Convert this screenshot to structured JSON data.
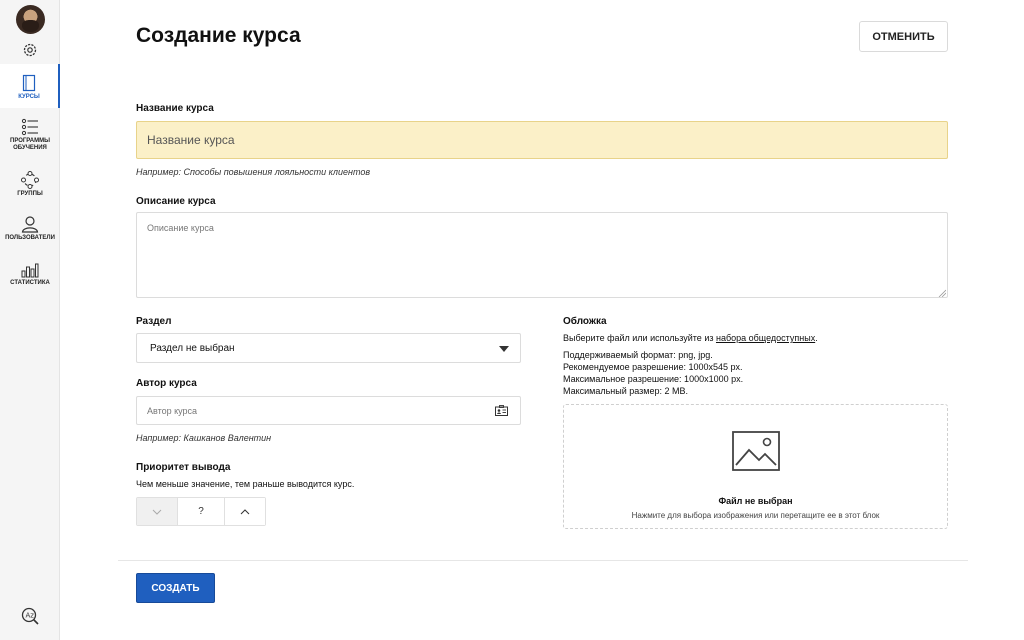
{
  "sidebar": {
    "items": [
      {
        "label": "КУРСЫ",
        "icon": "book-icon",
        "active": true
      },
      {
        "label": "ПРОГРАММЫ ОБУЧЕНИЯ",
        "icon": "list-icon"
      },
      {
        "label": "ГРУППЫ",
        "icon": "groups-icon"
      },
      {
        "label": "ПОЛЬЗОВАТЕЛИ",
        "icon": "user-icon"
      },
      {
        "label": "СТАТИСТИКА",
        "icon": "stats-icon"
      }
    ],
    "accent": "#1f5fbf"
  },
  "page": {
    "title": "Создание курса",
    "cancel_label": "ОТМЕНИТЬ"
  },
  "form": {
    "name": {
      "label": "Название курса",
      "placeholder": "Название курса",
      "hint": "Например: Способы повышения лояльности клиентов"
    },
    "description": {
      "label": "Описание курса",
      "placeholder": "Описание курса"
    },
    "section": {
      "label": "Раздел",
      "value": "Раздел не выбран"
    },
    "author": {
      "label": "Автор курса",
      "placeholder": "Автор курса",
      "hint": "Например: Кашканов Валентин"
    },
    "priority": {
      "label": "Приоритет вывода",
      "description": "Чем меньше значение, тем раньше выводится курс.",
      "value": "?"
    },
    "cover": {
      "label": "Обложка",
      "choose_prefix": "Выберите файл или используйте из ",
      "choose_link": "набора общедоступных",
      "choose_suffix": ".",
      "format": "Поддерживаемый формат: png, jpg.",
      "recommended": "Рекомендуемое разрешение: 1000x545 px.",
      "max_resolution": "Максимальное разрешение: 1000x1000 px.",
      "max_size": "Максимальный размер: 2 MB.",
      "no_file": "Файл не выбран",
      "drop_hint": "Нажмите для выбора изображения или перетащите ее в этот блок"
    },
    "create_label": "СОЗДАТЬ"
  }
}
